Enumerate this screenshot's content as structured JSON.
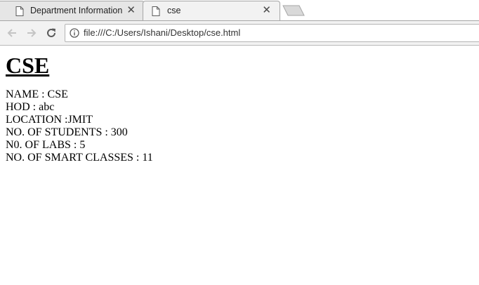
{
  "browser": {
    "tabs": [
      {
        "label": "Department Information",
        "active": false
      },
      {
        "label": "cse",
        "active": true
      }
    ],
    "address_bar": {
      "url": "file:///C:/Users/Ishani/Desktop/cse.html"
    },
    "icons": {
      "back": "back-arrow-icon",
      "forward": "forward-arrow-icon",
      "reload": "reload-icon",
      "info": "info-icon",
      "tab": "page-icon",
      "close": "close-icon"
    },
    "close_glyph": "✕"
  },
  "page": {
    "heading": "CSE",
    "lines": [
      "NAME : CSE",
      "HOD : abc",
      "LOCATION :JMIT",
      "NO. OF STUDENTS : 300",
      "N0. OF LABS : 5",
      "NO. OF SMART CLASSES : 11"
    ]
  }
}
